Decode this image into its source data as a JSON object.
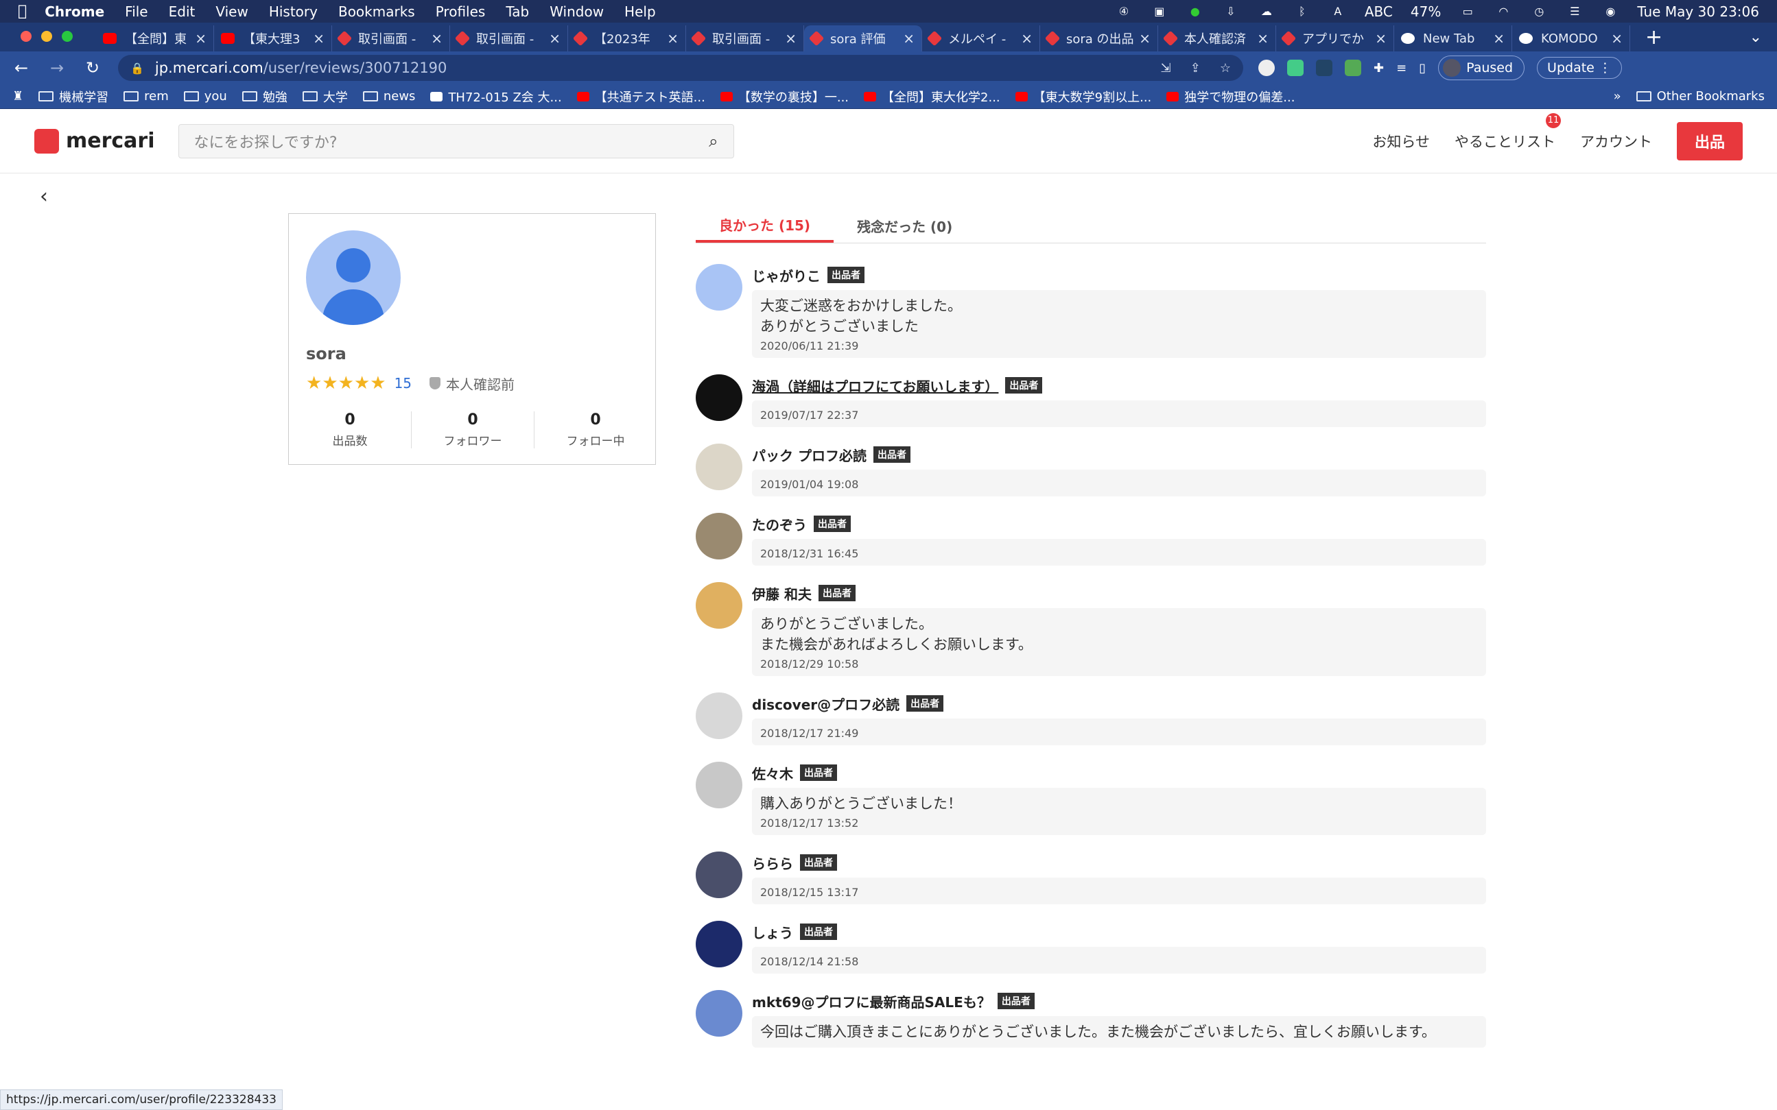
{
  "mac": {
    "app": "Chrome",
    "menus": [
      "File",
      "Edit",
      "View",
      "History",
      "Bookmarks",
      "Profiles",
      "Tab",
      "Window",
      "Help"
    ],
    "status_abc": "ABC",
    "battery": "47%",
    "datetime": "Tue May 30  23:06"
  },
  "tabs": [
    {
      "title": "【全問】東",
      "icon": "yt"
    },
    {
      "title": "【東大理3",
      "icon": "yt"
    },
    {
      "title": "取引画面 -",
      "icon": "mc"
    },
    {
      "title": "取引画面 -",
      "icon": "mc"
    },
    {
      "title": "【2023年",
      "icon": "mc"
    },
    {
      "title": "取引画面 -",
      "icon": "mc"
    },
    {
      "title": "sora 評価",
      "icon": "mc",
      "active": true
    },
    {
      "title": "メルペイ -",
      "icon": "mc"
    },
    {
      "title": "sora の出品",
      "icon": "mc"
    },
    {
      "title": "本人確認済",
      "icon": "mc"
    },
    {
      "title": "アプリでか",
      "icon": "mc"
    },
    {
      "title": "New Tab",
      "icon": "gg"
    },
    {
      "title": "KOMODO",
      "icon": "gg"
    }
  ],
  "address": {
    "host": "jp.mercari.com",
    "path": "/user/reviews/300712190",
    "paused": "Paused",
    "update": "Update"
  },
  "bookmarks": [
    {
      "label": "機械学習",
      "type": "folder"
    },
    {
      "label": "rem",
      "type": "folder"
    },
    {
      "label": "you",
      "type": "folder"
    },
    {
      "label": "勉強",
      "type": "folder"
    },
    {
      "label": "大学",
      "type": "folder"
    },
    {
      "label": "news",
      "type": "folder"
    },
    {
      "label": "TH72-015 Z会 大...",
      "type": "link"
    },
    {
      "label": "【共通テスト英語...",
      "type": "yt"
    },
    {
      "label": "【数学の裏技】一...",
      "type": "yt"
    },
    {
      "label": "【全問】東大化学2...",
      "type": "yt"
    },
    {
      "label": "【東大数学9割以上...",
      "type": "yt"
    },
    {
      "label": "独学で物理の偏差...",
      "type": "yt"
    }
  ],
  "bookmarks_more": "»",
  "bookmarks_other": "Other Bookmarks",
  "header": {
    "logo": "mercari",
    "search_placeholder": "なにをお探しですか?",
    "notifications": "お知らせ",
    "todo": "やることリスト",
    "todo_badge": "11",
    "account": "アカウント",
    "sell": "出品"
  },
  "profile": {
    "name": "sora",
    "stars": 5,
    "rating_count": "15",
    "verify": "本人確認前",
    "stats": [
      {
        "n": "0",
        "l": "出品数"
      },
      {
        "n": "0",
        "l": "フォロワー"
      },
      {
        "n": "0",
        "l": "フォロー中"
      }
    ]
  },
  "review_tabs": {
    "good": "良かった (15)",
    "bad": "残念だった (0)"
  },
  "seller_tag": "出品者",
  "reviews": [
    {
      "name": "じゃがりこ",
      "text": "大変ご迷惑をおかけしました。\nありがとうございました",
      "date": "2020/06/11 21:39",
      "avatar": "#a9c4f5"
    },
    {
      "name": "海渦（詳細はプロフにてお願いします）",
      "link": true,
      "text": "",
      "date": "2019/07/17 22:37",
      "avatar": "#111"
    },
    {
      "name": "パック プロフ必読",
      "text": "",
      "date": "2019/01/04 19:08",
      "avatar": "#dcd6c8"
    },
    {
      "name": "たのぞう",
      "text": "",
      "date": "2018/12/31 16:45",
      "avatar": "#9a8a70"
    },
    {
      "name": "伊藤 和夫",
      "text": "ありがとうございました。\nまた機会があればよろしくお願いします。",
      "date": "2018/12/29 10:58",
      "avatar": "#e0b060"
    },
    {
      "name": "discover@プロフ必読",
      "text": "",
      "date": "2018/12/17 21:49",
      "avatar": "#d8d8d8"
    },
    {
      "name": "佐々木",
      "text": "購入ありがとうございました！",
      "date": "2018/12/17 13:52",
      "avatar": "#c8c8c8"
    },
    {
      "name": "ららら",
      "text": "",
      "date": "2018/12/15 13:17",
      "avatar": "#4a4f6a"
    },
    {
      "name": "しょう",
      "text": "",
      "date": "2018/12/14 21:58",
      "avatar": "#1c2a6a"
    },
    {
      "name": "mkt69@プロフに最新商品SALEも？",
      "text": "今回はご購入頂きまことにありがとうございました。また機会がございましたら、宜しくお願いします。",
      "date": "",
      "avatar": "#6a8ad0"
    }
  ],
  "status_url": "https://jp.mercari.com/user/profile/223328433",
  "colors": {
    "brand": "#e8383d",
    "link": "#2f6ed4",
    "star": "#f3b31f"
  }
}
